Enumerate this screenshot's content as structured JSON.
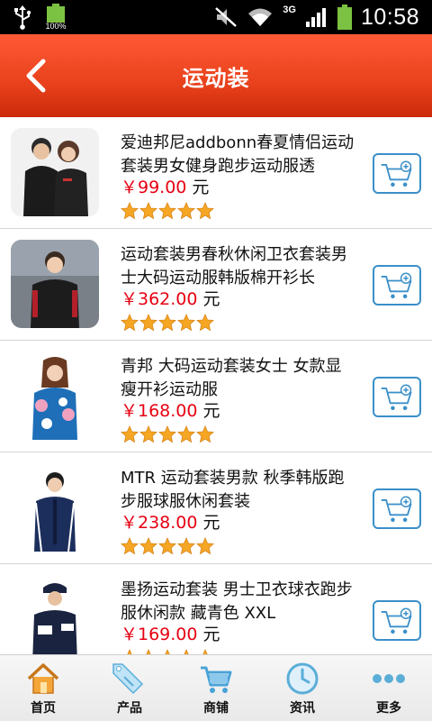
{
  "status_bar": {
    "battery_percent": "100%",
    "network_type": "3G",
    "time": "10:58"
  },
  "header": {
    "title": "运动装",
    "back_icon": "chevron-left-icon"
  },
  "products": [
    {
      "name": "爱迪邦尼addbonn春夏情侣运动套装男女健身跑步运动服透",
      "price": "￥99.00",
      "unit": "元",
      "rating": 5,
      "cart_icon": "add-to-cart-icon"
    },
    {
      "name": "运动套装男春秋休闲卫衣套装男士大码运动服韩版棉开衫长",
      "price": "￥362.00",
      "unit": "元",
      "rating": 5,
      "cart_icon": "add-to-cart-icon"
    },
    {
      "name": "青邦 大码运动套装女士 女款显瘦开衫运动服",
      "price": "￥168.00",
      "unit": "元",
      "rating": 5,
      "cart_icon": "add-to-cart-icon"
    },
    {
      "name": "MTR 运动套装男款 秋季韩版跑步服球服休闲套装",
      "price": "￥238.00",
      "unit": "元",
      "rating": 5,
      "cart_icon": "add-to-cart-icon"
    },
    {
      "name": "墨扬运动套装 男士卫衣球衣跑步服休闲款 藏青色 XXL",
      "price": "￥169.00",
      "unit": "元",
      "rating": 5,
      "cart_icon": "add-to-cart-icon"
    }
  ],
  "bottom_nav": [
    {
      "label": "首页",
      "icon": "home-icon"
    },
    {
      "label": "产品",
      "icon": "sale-tag-icon"
    },
    {
      "label": "商铺",
      "icon": "shopping-cart-icon"
    },
    {
      "label": "资讯",
      "icon": "clock-icon"
    },
    {
      "label": "更多",
      "icon": "more-dots-icon"
    }
  ],
  "colors": {
    "header": "#e8411c",
    "price": "#e60012",
    "cart_border": "#3a8fc9",
    "star": "#f5a623"
  }
}
